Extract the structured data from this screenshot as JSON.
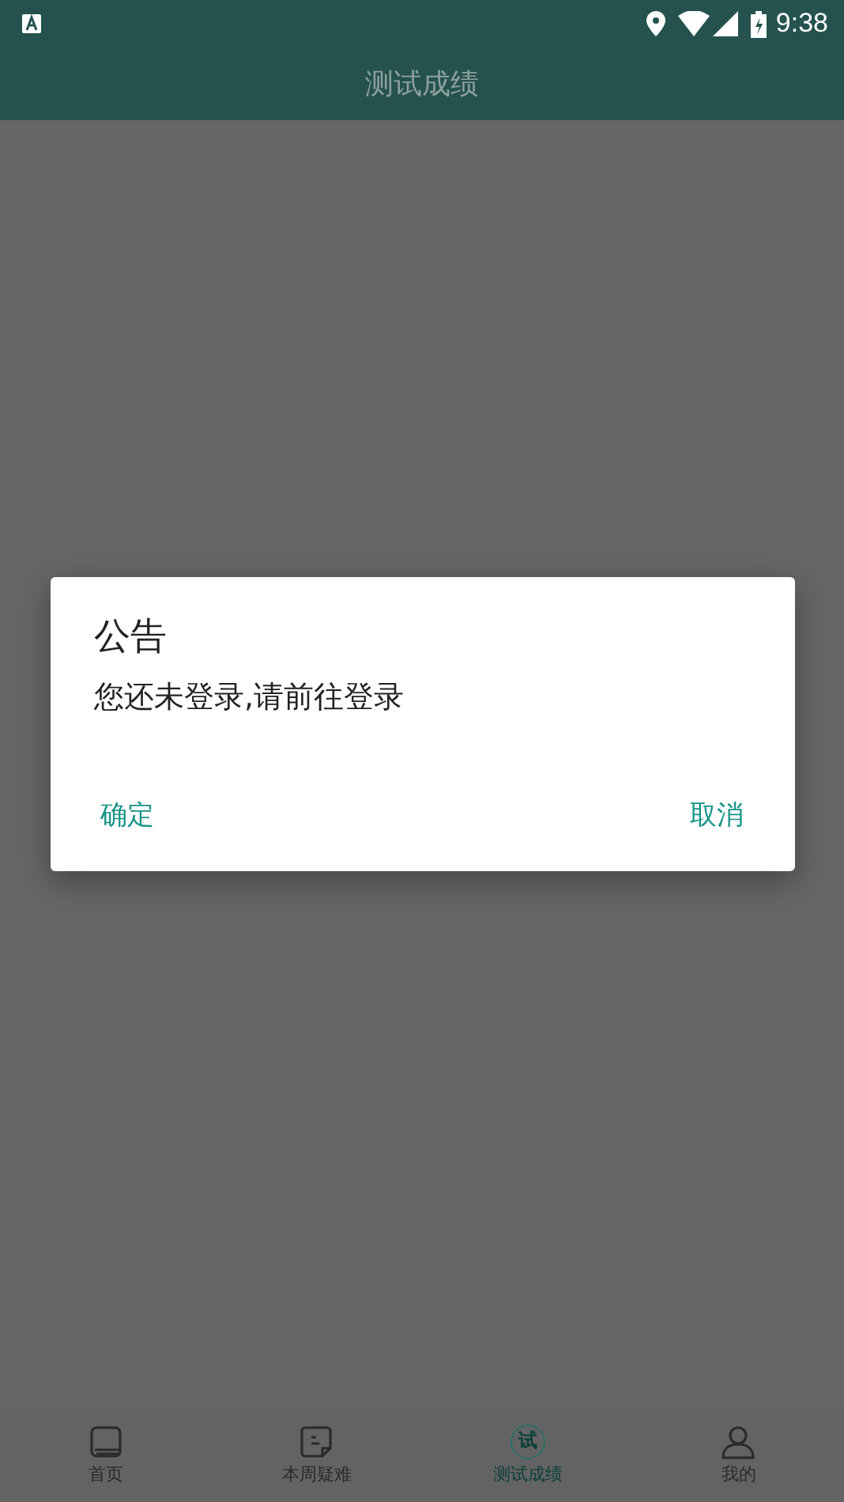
{
  "status_bar": {
    "time": "9:38"
  },
  "app_bar": {
    "title": "测试成绩"
  },
  "dialog": {
    "title": "公告",
    "message": "您还未登录,请前往登录",
    "buttons": [
      "确定",
      "取消"
    ]
  },
  "nav": [
    {
      "label": "首页",
      "kind": "book",
      "selected": false
    },
    {
      "label": "本周疑难",
      "kind": "note",
      "selected": false
    },
    {
      "label": "测试成绩",
      "kind": "badge",
      "badge_text": "试",
      "selected": true
    },
    {
      "label": "我的",
      "kind": "person",
      "selected": false
    }
  ]
}
